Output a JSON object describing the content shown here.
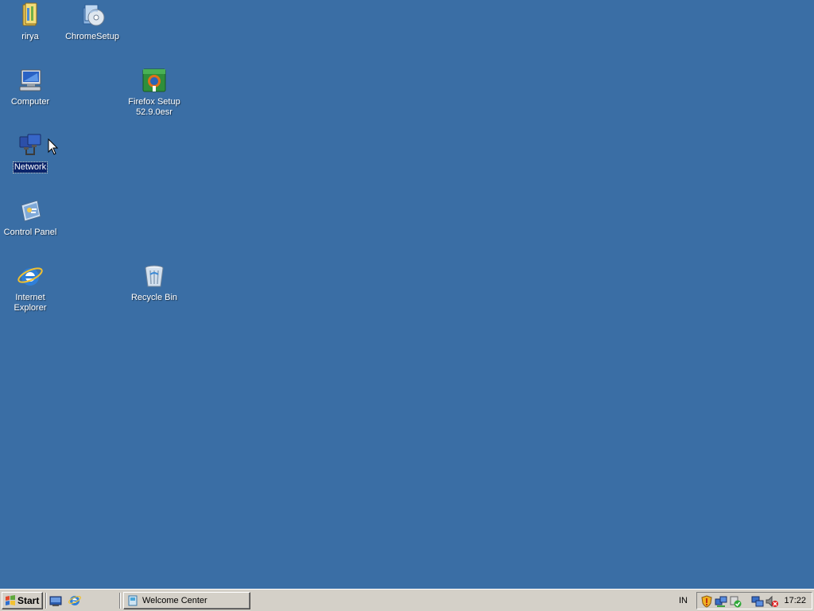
{
  "desktop": {
    "background_color": "#3a6ea5",
    "icons": [
      {
        "label": "rirya",
        "icon": "user-folder-icon"
      },
      {
        "label": "ChromeSetup",
        "icon": "installer-cd-icon"
      },
      {
        "label": "Computer",
        "icon": "computer-icon"
      },
      {
        "label": "Firefox Setup 52.9.0esr",
        "icon": "firefox-installer-icon"
      },
      {
        "label": "Network",
        "icon": "network-icon",
        "selected": true
      },
      {
        "label": "Control Panel",
        "icon": "control-panel-icon"
      },
      {
        "label": "Internet Explorer",
        "icon": "internet-explorer-icon"
      },
      {
        "label": "Recycle Bin",
        "icon": "recycle-bin-icon"
      }
    ]
  },
  "taskbar": {
    "start_label": "Start",
    "quick_launch": [
      "show-desktop-icon",
      "internet-explorer-icon"
    ],
    "tasks": [
      {
        "label": "Welcome Center",
        "icon": "welcome-center-icon"
      }
    ],
    "language": "IN",
    "tray_icons": [
      "security-shield-icon",
      "network-status-icon",
      "security-check-icon",
      "network-connection-icon",
      "volume-muted-icon"
    ],
    "clock": "17:22"
  }
}
